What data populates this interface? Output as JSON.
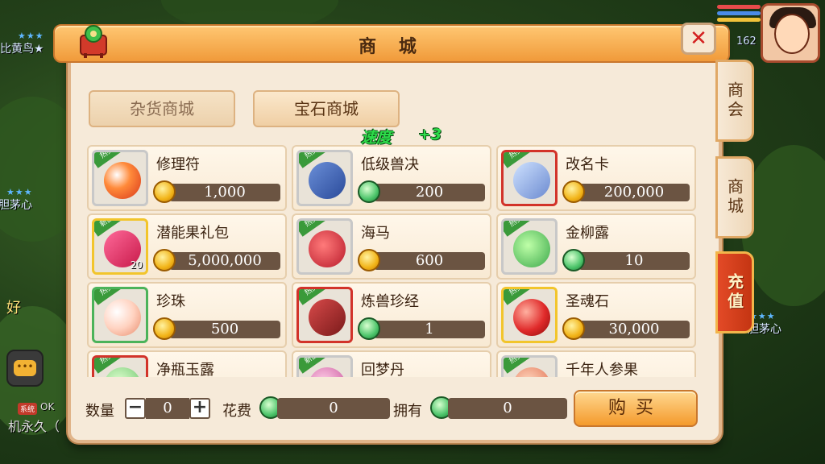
{
  "background": {
    "player_names": [
      "比黄鸟★",
      "胆茅心",
      "胆茅心"
    ],
    "chat_tag": "OK",
    "chat_line": "机永久（",
    "level": "162",
    "partial_text": "好"
  },
  "window": {
    "title": "商 城",
    "close_label": "✕"
  },
  "side_tabs": [
    {
      "label": "商会"
    },
    {
      "label": "商城"
    },
    {
      "label": "充值"
    }
  ],
  "categories": [
    {
      "label": "杂货商城"
    },
    {
      "label": "宝石商城"
    }
  ],
  "floating_text": {
    "label": "速度",
    "value": "+3"
  },
  "items": [
    {
      "name": "修理符",
      "price": "1,000",
      "currency": "gold",
      "tag": "热卖",
      "icon": "orange-orb-icon",
      "frame": "grey"
    },
    {
      "name": "低级兽决",
      "price": "200",
      "currency": "jade",
      "tag": "热卖",
      "icon": "blue-book-icon",
      "frame": "grey"
    },
    {
      "name": "改名卡",
      "price": "200,000",
      "currency": "gold",
      "tag": "热卖",
      "icon": "name-card-icon",
      "frame": "red"
    },
    {
      "name": "潜能果礼包",
      "price": "5,000,000",
      "currency": "gold",
      "tag": "新品",
      "icon": "gift-box-icon",
      "frame": "gold",
      "count": "20"
    },
    {
      "name": "海马",
      "price": "600",
      "currency": "gold",
      "tag": "热卖",
      "icon": "seahorse-icon",
      "frame": "grey"
    },
    {
      "name": "金柳露",
      "price": "10",
      "currency": "jade",
      "tag": "热卖",
      "icon": "gourd-icon",
      "frame": "grey"
    },
    {
      "name": "珍珠",
      "price": "500",
      "currency": "gold",
      "tag": "热卖",
      "icon": "pearl-icon",
      "frame": "green"
    },
    {
      "name": "炼兽珍经",
      "price": "1",
      "currency": "jade",
      "tag": "热卖",
      "icon": "red-book-icon",
      "frame": "red"
    },
    {
      "name": "圣魂石",
      "price": "30,000",
      "currency": "gold",
      "tag": "热卖",
      "icon": "red-gem-icon",
      "frame": "gold"
    },
    {
      "name": "净瓶玉露",
      "price": "",
      "currency": "jade",
      "tag": "热卖",
      "icon": "vase-icon",
      "frame": "red"
    },
    {
      "name": "回梦丹",
      "price": "",
      "currency": "jade",
      "tag": "新品",
      "icon": "pill-icon",
      "frame": "grey"
    },
    {
      "name": "千年人参果",
      "price": "",
      "currency": "jade",
      "tag": "热卖",
      "icon": "ginseng-icon",
      "frame": "grey"
    }
  ],
  "purchase": {
    "qty_label": "数量",
    "qty_value": "0",
    "minus": "−",
    "plus": "+",
    "cost_label": "花费",
    "cost_value": "0",
    "own_label": "拥有",
    "own_value": "0",
    "buy_label": "购买"
  }
}
